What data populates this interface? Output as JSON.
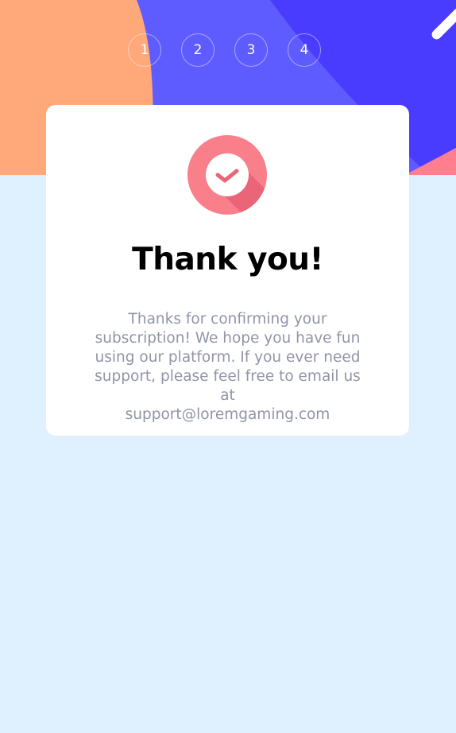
{
  "steps": [
    "1",
    "2",
    "3",
    "4"
  ],
  "card": {
    "icon": "check-circle-icon",
    "title": "Thank you!",
    "message": "Thanks for confirming your subscription! We hope you have fun using our platform. If you ever need support, please feel free to email us at",
    "email": "support@loremgaming.com"
  },
  "colors": {
    "background": "#dff0fe",
    "header_purple": "#5f5cff",
    "header_blue": "#4a3cff",
    "header_orange": "#ffa97a",
    "accent_pink": "#f97f8b",
    "text_muted": "#9095a7"
  }
}
